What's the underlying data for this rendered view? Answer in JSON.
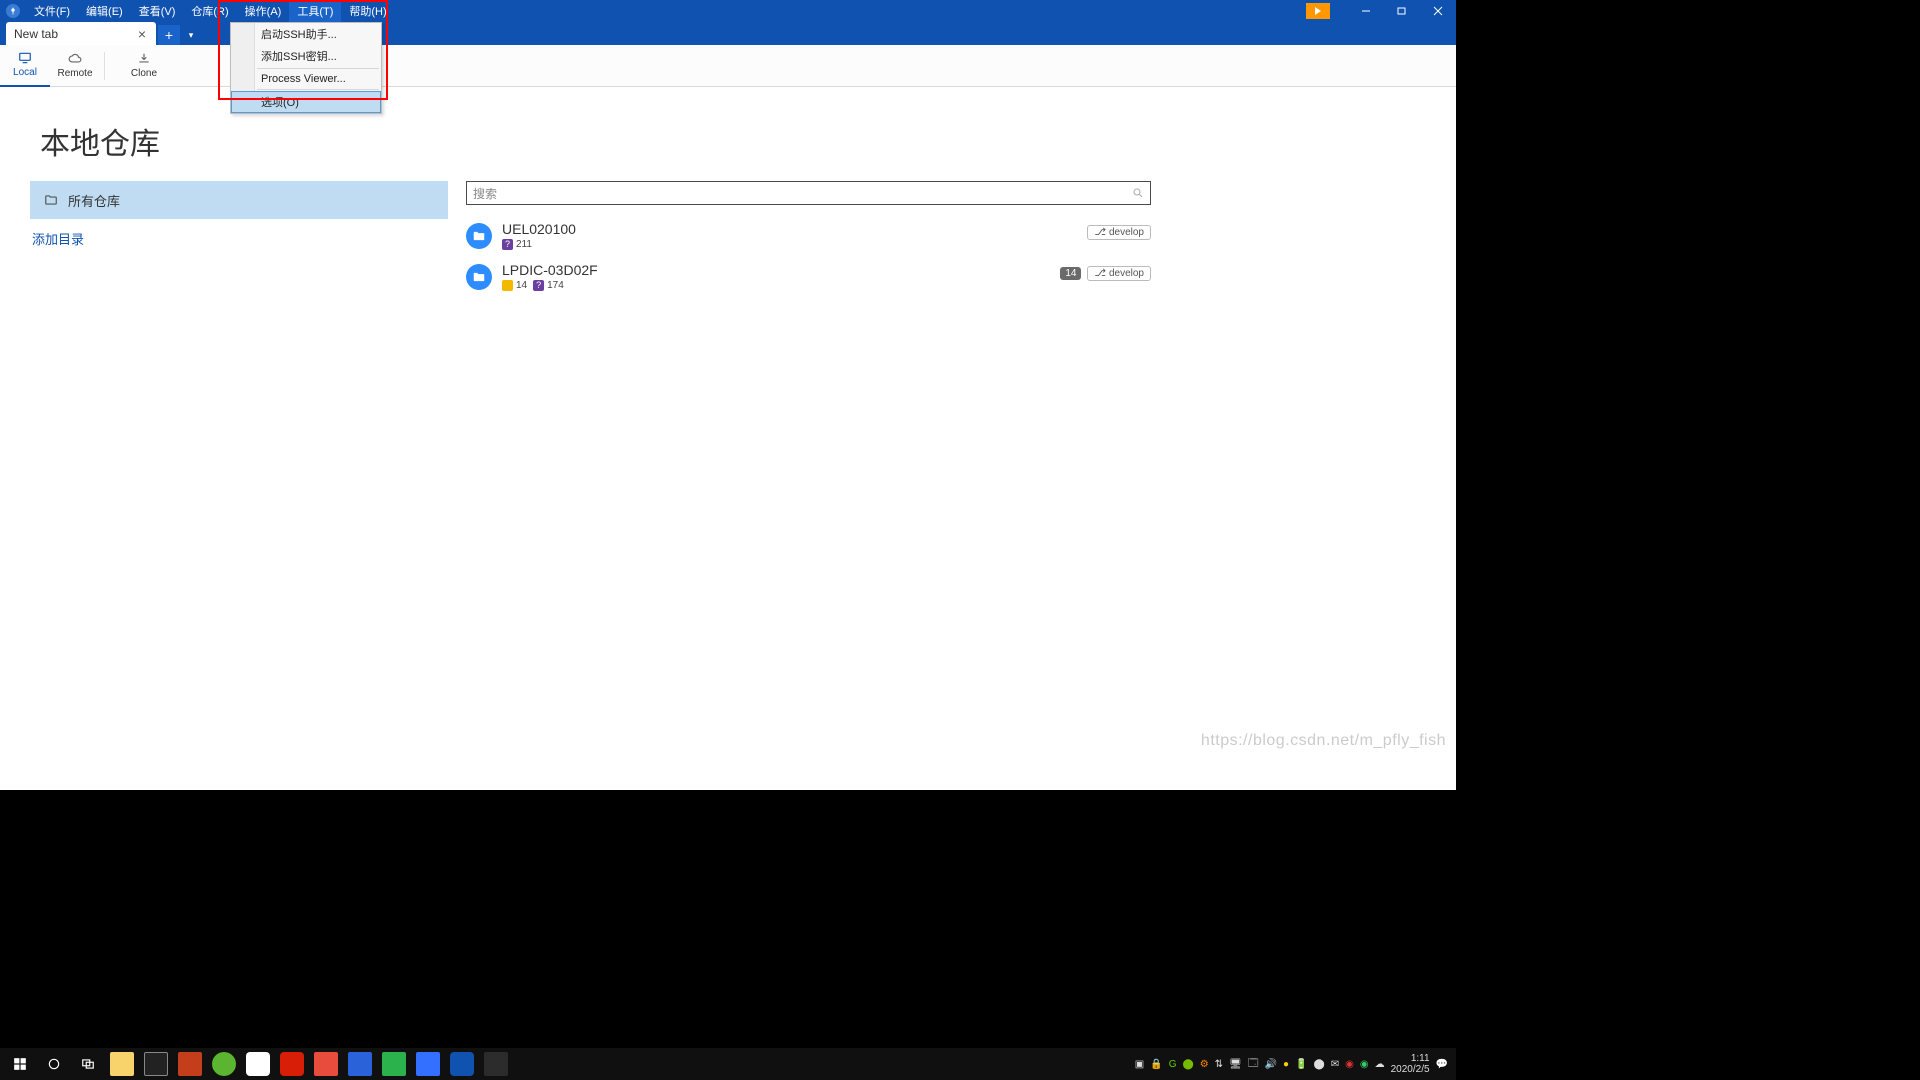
{
  "menubar": {
    "items": [
      "文件(F)",
      "编辑(E)",
      "查看(V)",
      "仓库(R)",
      "操作(A)",
      "工具(T)",
      "帮助(H)"
    ],
    "active_index": 5
  },
  "window_controls": {
    "minimize": "–",
    "maximize": "❐",
    "close": "✕"
  },
  "tabs": {
    "active": {
      "label": "New tab"
    }
  },
  "toolbar": {
    "local": "Local",
    "remote": "Remote",
    "clone": "Clone"
  },
  "tools_menu": {
    "items": [
      {
        "label": "启动SSH助手..."
      },
      {
        "label": "添加SSH密钥..."
      },
      {
        "label": "Process Viewer..."
      },
      {
        "label": "选项(O)",
        "highlighted": true
      }
    ]
  },
  "main": {
    "title": "本地仓库",
    "sidebar": {
      "all_repos": "所有仓库",
      "add_dir": "添加目录"
    },
    "search_placeholder": "搜索",
    "repos": [
      {
        "name": "UEL020100",
        "meta": [
          {
            "color": "purple",
            "icon": "?",
            "value": "211"
          }
        ],
        "branch": "develop"
      },
      {
        "name": "LPDIC-03D02F",
        "meta": [
          {
            "color": "yellow",
            "icon": "",
            "value": "14"
          },
          {
            "color": "purple",
            "icon": "?",
            "value": "174"
          }
        ],
        "count": "14",
        "branch": "develop"
      }
    ]
  },
  "watermark": "https://blog.csdn.net/m_pfly_fish",
  "tray": {
    "time": "1:11",
    "date": "2020/2/5"
  }
}
